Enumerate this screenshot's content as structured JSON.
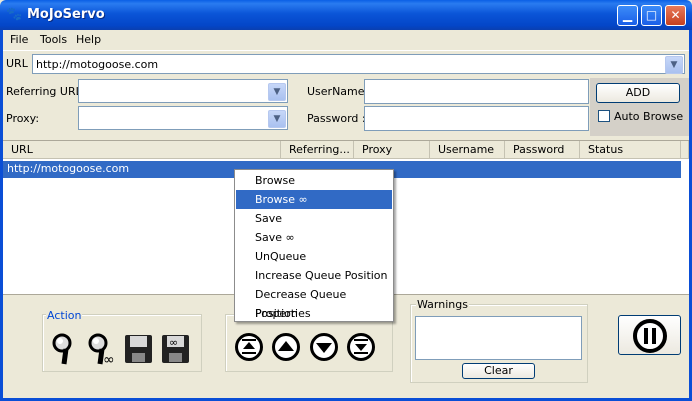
{
  "window": {
    "title": "MoJoServo"
  },
  "menubar": {
    "items": [
      "File",
      "Tools",
      "Help"
    ]
  },
  "form": {
    "url_label": "URL :",
    "url_value": "http://motogoose.com",
    "referring_label": "Referring URL:",
    "proxy_label": "Proxy:",
    "username_label": "UserName :",
    "password_label": "Password :",
    "add_label": "ADD",
    "auto_browse_label": "Auto Browse"
  },
  "table": {
    "columns": [
      "URL",
      "Referring...",
      "Proxy",
      "Username",
      "Password",
      "Status"
    ],
    "rows": [
      {
        "url": "http://motogoose.com"
      }
    ]
  },
  "context_menu": {
    "items": [
      "Browse",
      "Browse ∞",
      "Save",
      "Save ∞",
      "UnQueue",
      "Increase Queue Position",
      "Decrease Queue Position",
      "Properties"
    ],
    "selected_index": 1
  },
  "action_group": {
    "label": "Action"
  },
  "warnings": {
    "label": "Warnings",
    "clear_label": "Clear"
  },
  "colors": {
    "title_bar": "#0a55d8",
    "selection": "#316ac5",
    "face": "#ece9d8"
  },
  "icons": [
    "app-icon",
    "minimize-icon",
    "maximize-icon",
    "close-icon",
    "browse-icon",
    "browse-infinite-icon",
    "save-icon",
    "save-infinite-icon",
    "move-top-icon",
    "move-up-icon",
    "move-down-icon",
    "move-bottom-icon",
    "pause-icon"
  ]
}
